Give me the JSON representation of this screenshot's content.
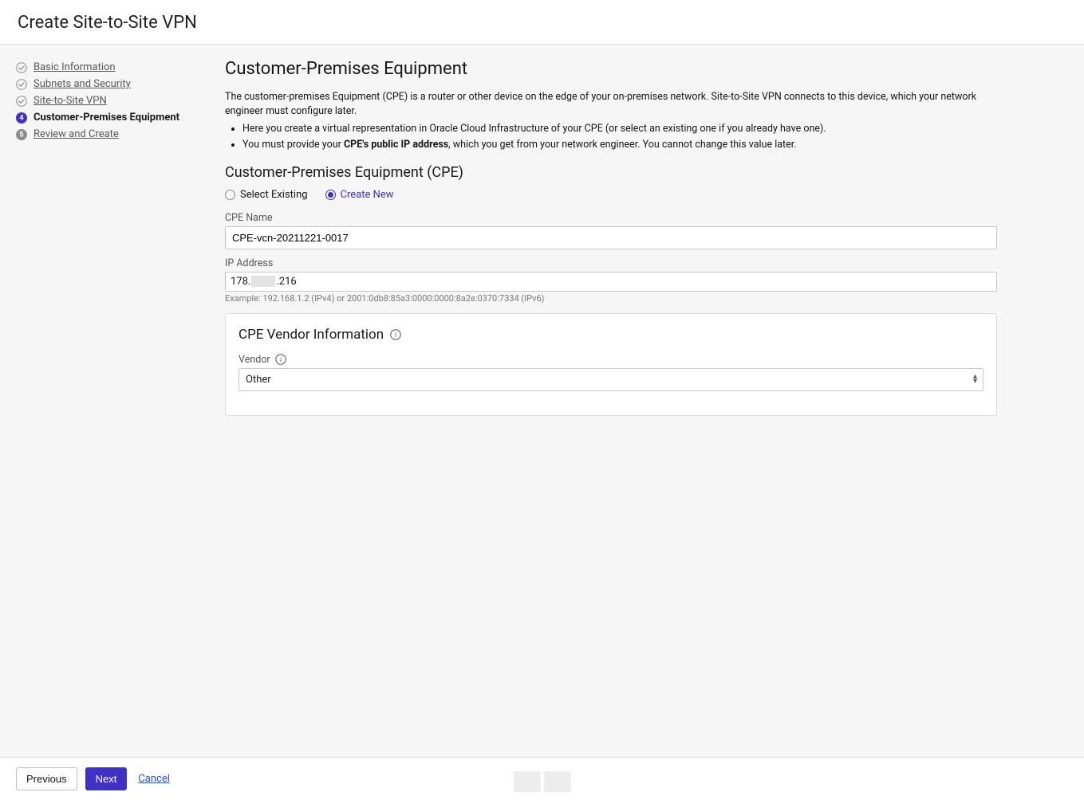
{
  "header": {
    "title": "Create Site-to-Site VPN"
  },
  "steps": [
    {
      "label": "Basic Information",
      "state": "completed"
    },
    {
      "label": "Subnets and Security",
      "state": "completed"
    },
    {
      "label": "Site-to-Site VPN",
      "state": "completed"
    },
    {
      "label": "Customer-Premises Equipment",
      "state": "active",
      "num": "4"
    },
    {
      "label": "Review and Create",
      "state": "pending",
      "num": "5"
    }
  ],
  "main": {
    "heading": "Customer-Premises Equipment",
    "intro": "The customer-premises Equipment (CPE) is a router or other device on the edge of your on-premises network. Site-to-Site VPN connects to this device, which your network engineer must configure later.",
    "bullets": {
      "b1": "Here you create a virtual representation in Oracle Cloud Infrastructure of your CPE (or select an existing one if you already have one).",
      "b2a": "You must provide your ",
      "b2b": "CPE's public IP address",
      "b2c": ", which you get from your network engineer. You cannot change this value later."
    },
    "section_title": "Customer-Premises Equipment (CPE)",
    "radios": {
      "select_existing": "Select Existing",
      "create_new": "Create New",
      "selected": "create_new"
    },
    "cpe_name": {
      "label": "CPE Name",
      "value": "CPE-vcn-20211221-0017"
    },
    "ip": {
      "label": "IP Address",
      "part1": "178.",
      "part2": ".216",
      "hint": "Example: 192.168.1.2 (IPv4) or 2001:0db8:85a3:0000:0000:8a2e:0370:7334 (IPv6)"
    },
    "vendor_panel": {
      "title": "CPE Vendor Information",
      "vendor_label": "Vendor",
      "vendor_value": "Other"
    }
  },
  "footer": {
    "previous": "Previous",
    "next": "Next",
    "cancel": "Cancel"
  }
}
